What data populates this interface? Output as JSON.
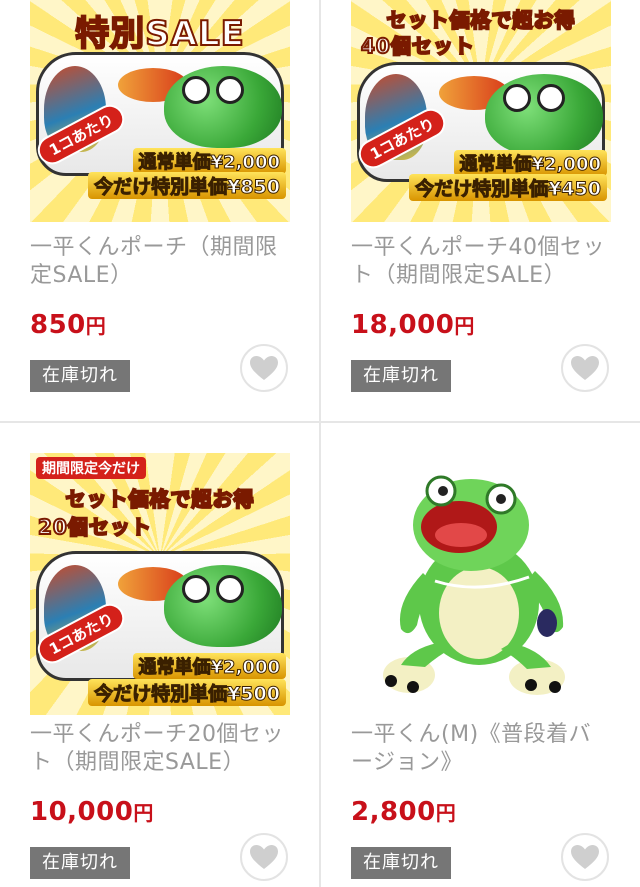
{
  "products": [
    {
      "title": "一平くんポーチ（期間限定SALE）",
      "price": "850",
      "currency": "円",
      "status": "在庫切れ",
      "image": {
        "kind": "promo",
        "tag": "",
        "headline_1": "特別SALE",
        "headline_2": "",
        "badge": "1コあたり",
        "regular": "通常単価¥2,000",
        "special": "今だけ特別単価¥850"
      }
    },
    {
      "title": "一平くんポーチ40個セット（期間限定SALE）",
      "price": "18,000",
      "currency": "円",
      "status": "在庫切れ",
      "image": {
        "kind": "promo",
        "tag": "",
        "headline_1": "セット価格で超お得",
        "headline_2": "40個セット",
        "badge": "1コあたり",
        "regular": "通常単価¥2,000",
        "special": "今だけ特別単価¥450"
      }
    },
    {
      "title": "一平くんポーチ20個セット（期間限定SALE）",
      "price": "10,000",
      "currency": "円",
      "status": "在庫切れ",
      "image": {
        "kind": "promo",
        "tag": "期間限定今だけ",
        "headline_1": "セット価格で超お得",
        "headline_2": "20個セット",
        "badge": "1コあたり",
        "regular": "通常単価¥2,000",
        "special": "今だけ特別単価¥500"
      }
    },
    {
      "title": "一平くん(M)《普段着バージョン》",
      "price": "2,800",
      "currency": "円",
      "status": "在庫切れ",
      "image": {
        "kind": "plush-frog"
      }
    }
  ],
  "icons": {
    "favorite": "heart-icon"
  },
  "colors": {
    "price": "#c8101a",
    "soldout_bg": "#767676",
    "title": "#999999",
    "divider": "#e6e6e6"
  }
}
